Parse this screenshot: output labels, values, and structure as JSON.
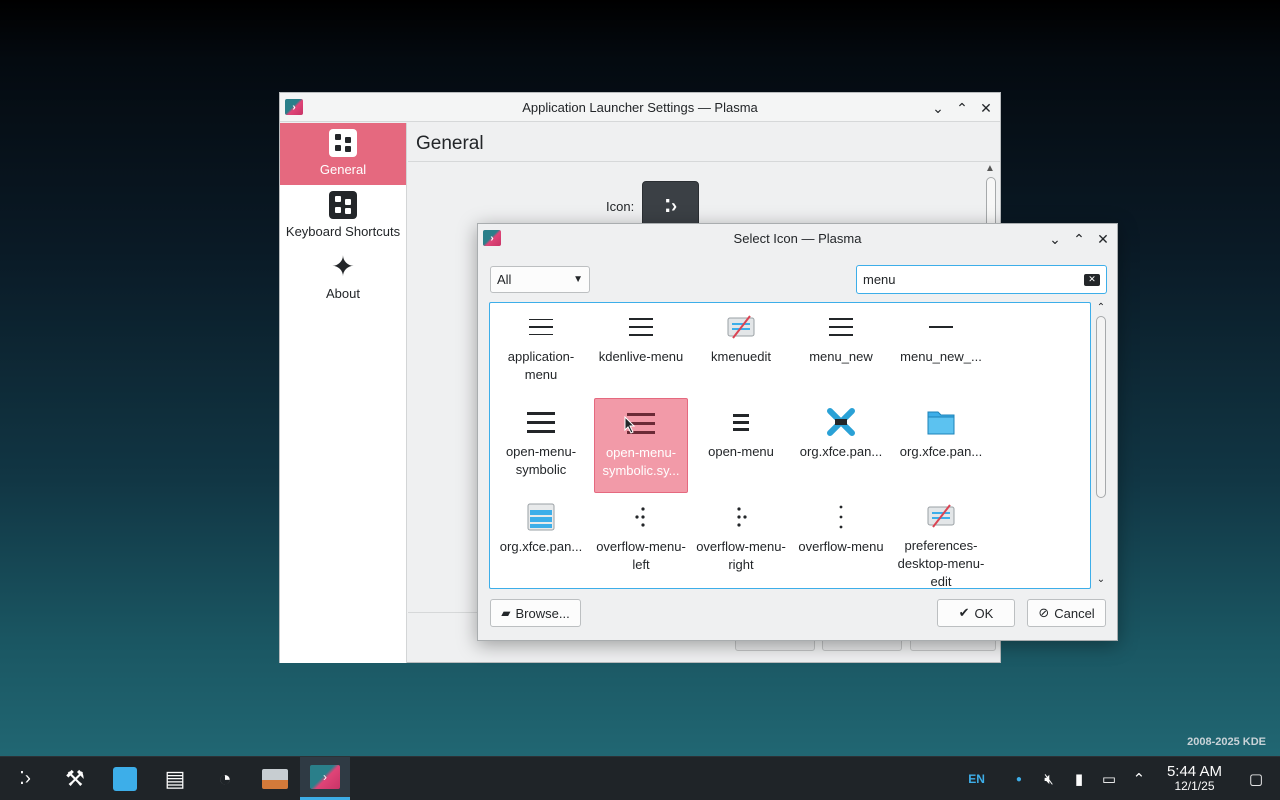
{
  "settings_window": {
    "title": "Application Launcher Settings — Plasma",
    "sidebar": [
      {
        "label": "General",
        "icon": "general-settings-icon"
      },
      {
        "label": "Keyboard Shortcuts",
        "icon": "keyboard-shortcuts-icon"
      },
      {
        "label": "About",
        "icon": "about-star-icon"
      }
    ],
    "section_title": "General",
    "icon_label": "Icon:"
  },
  "dialog": {
    "title": "Select Icon — Plasma",
    "filter_selected": "All",
    "search_value": "menu",
    "icons": [
      {
        "name": "application-menu",
        "glyph": "hamburger-thin-icon"
      },
      {
        "name": "kdenlive-menu",
        "glyph": "hamburger-icon"
      },
      {
        "name": "kmenuedit",
        "glyph": "kmenuedit-icon"
      },
      {
        "name": "menu_new",
        "glyph": "hamburger-icon"
      },
      {
        "name": "menu_new_...",
        "glyph": "single-line-icon"
      },
      {
        "name": "open-menu-symbolic",
        "glyph": "hamburger-thick-icon"
      },
      {
        "name": "open-menu-symbolic.sy...",
        "glyph": "hamburger-thick-icon"
      },
      {
        "name": "open-menu",
        "glyph": "hamburger-small-icon"
      },
      {
        "name": "org.xfce.pan...",
        "glyph": "xfce-panel-x-icon"
      },
      {
        "name": "org.xfce.pan...",
        "glyph": "folder-icon"
      },
      {
        "name": "org.xfce.pan...",
        "glyph": "panel-stack-icon"
      },
      {
        "name": "overflow-menu-left",
        "glyph": "overflow-left-icon"
      },
      {
        "name": "overflow-menu-right",
        "glyph": "overflow-right-icon"
      },
      {
        "name": "overflow-menu",
        "glyph": "overflow-vertical-icon"
      },
      {
        "name": "preferences-desktop-menu-edit",
        "glyph": "kmenuedit-icon"
      }
    ],
    "selected_index": 6,
    "browse_label": "Browse...",
    "ok_label": "OK",
    "cancel_label": "Cancel"
  },
  "taskbar": {
    "apps": [
      "application-launcher-icon",
      "system-settings-icon",
      "discover-store-icon",
      "file-manager-icon",
      "system-monitor-icon",
      "image-viewer-icon",
      "plasma-settings-icon"
    ],
    "active_index": 6,
    "language": "EN",
    "time": "5:44 AM",
    "date": "12/1/25"
  },
  "watermark": "2008-2025 KDE",
  "colors": {
    "accent": "#e5697f",
    "selection": "#f29aa8",
    "focus": "#3daee9"
  }
}
